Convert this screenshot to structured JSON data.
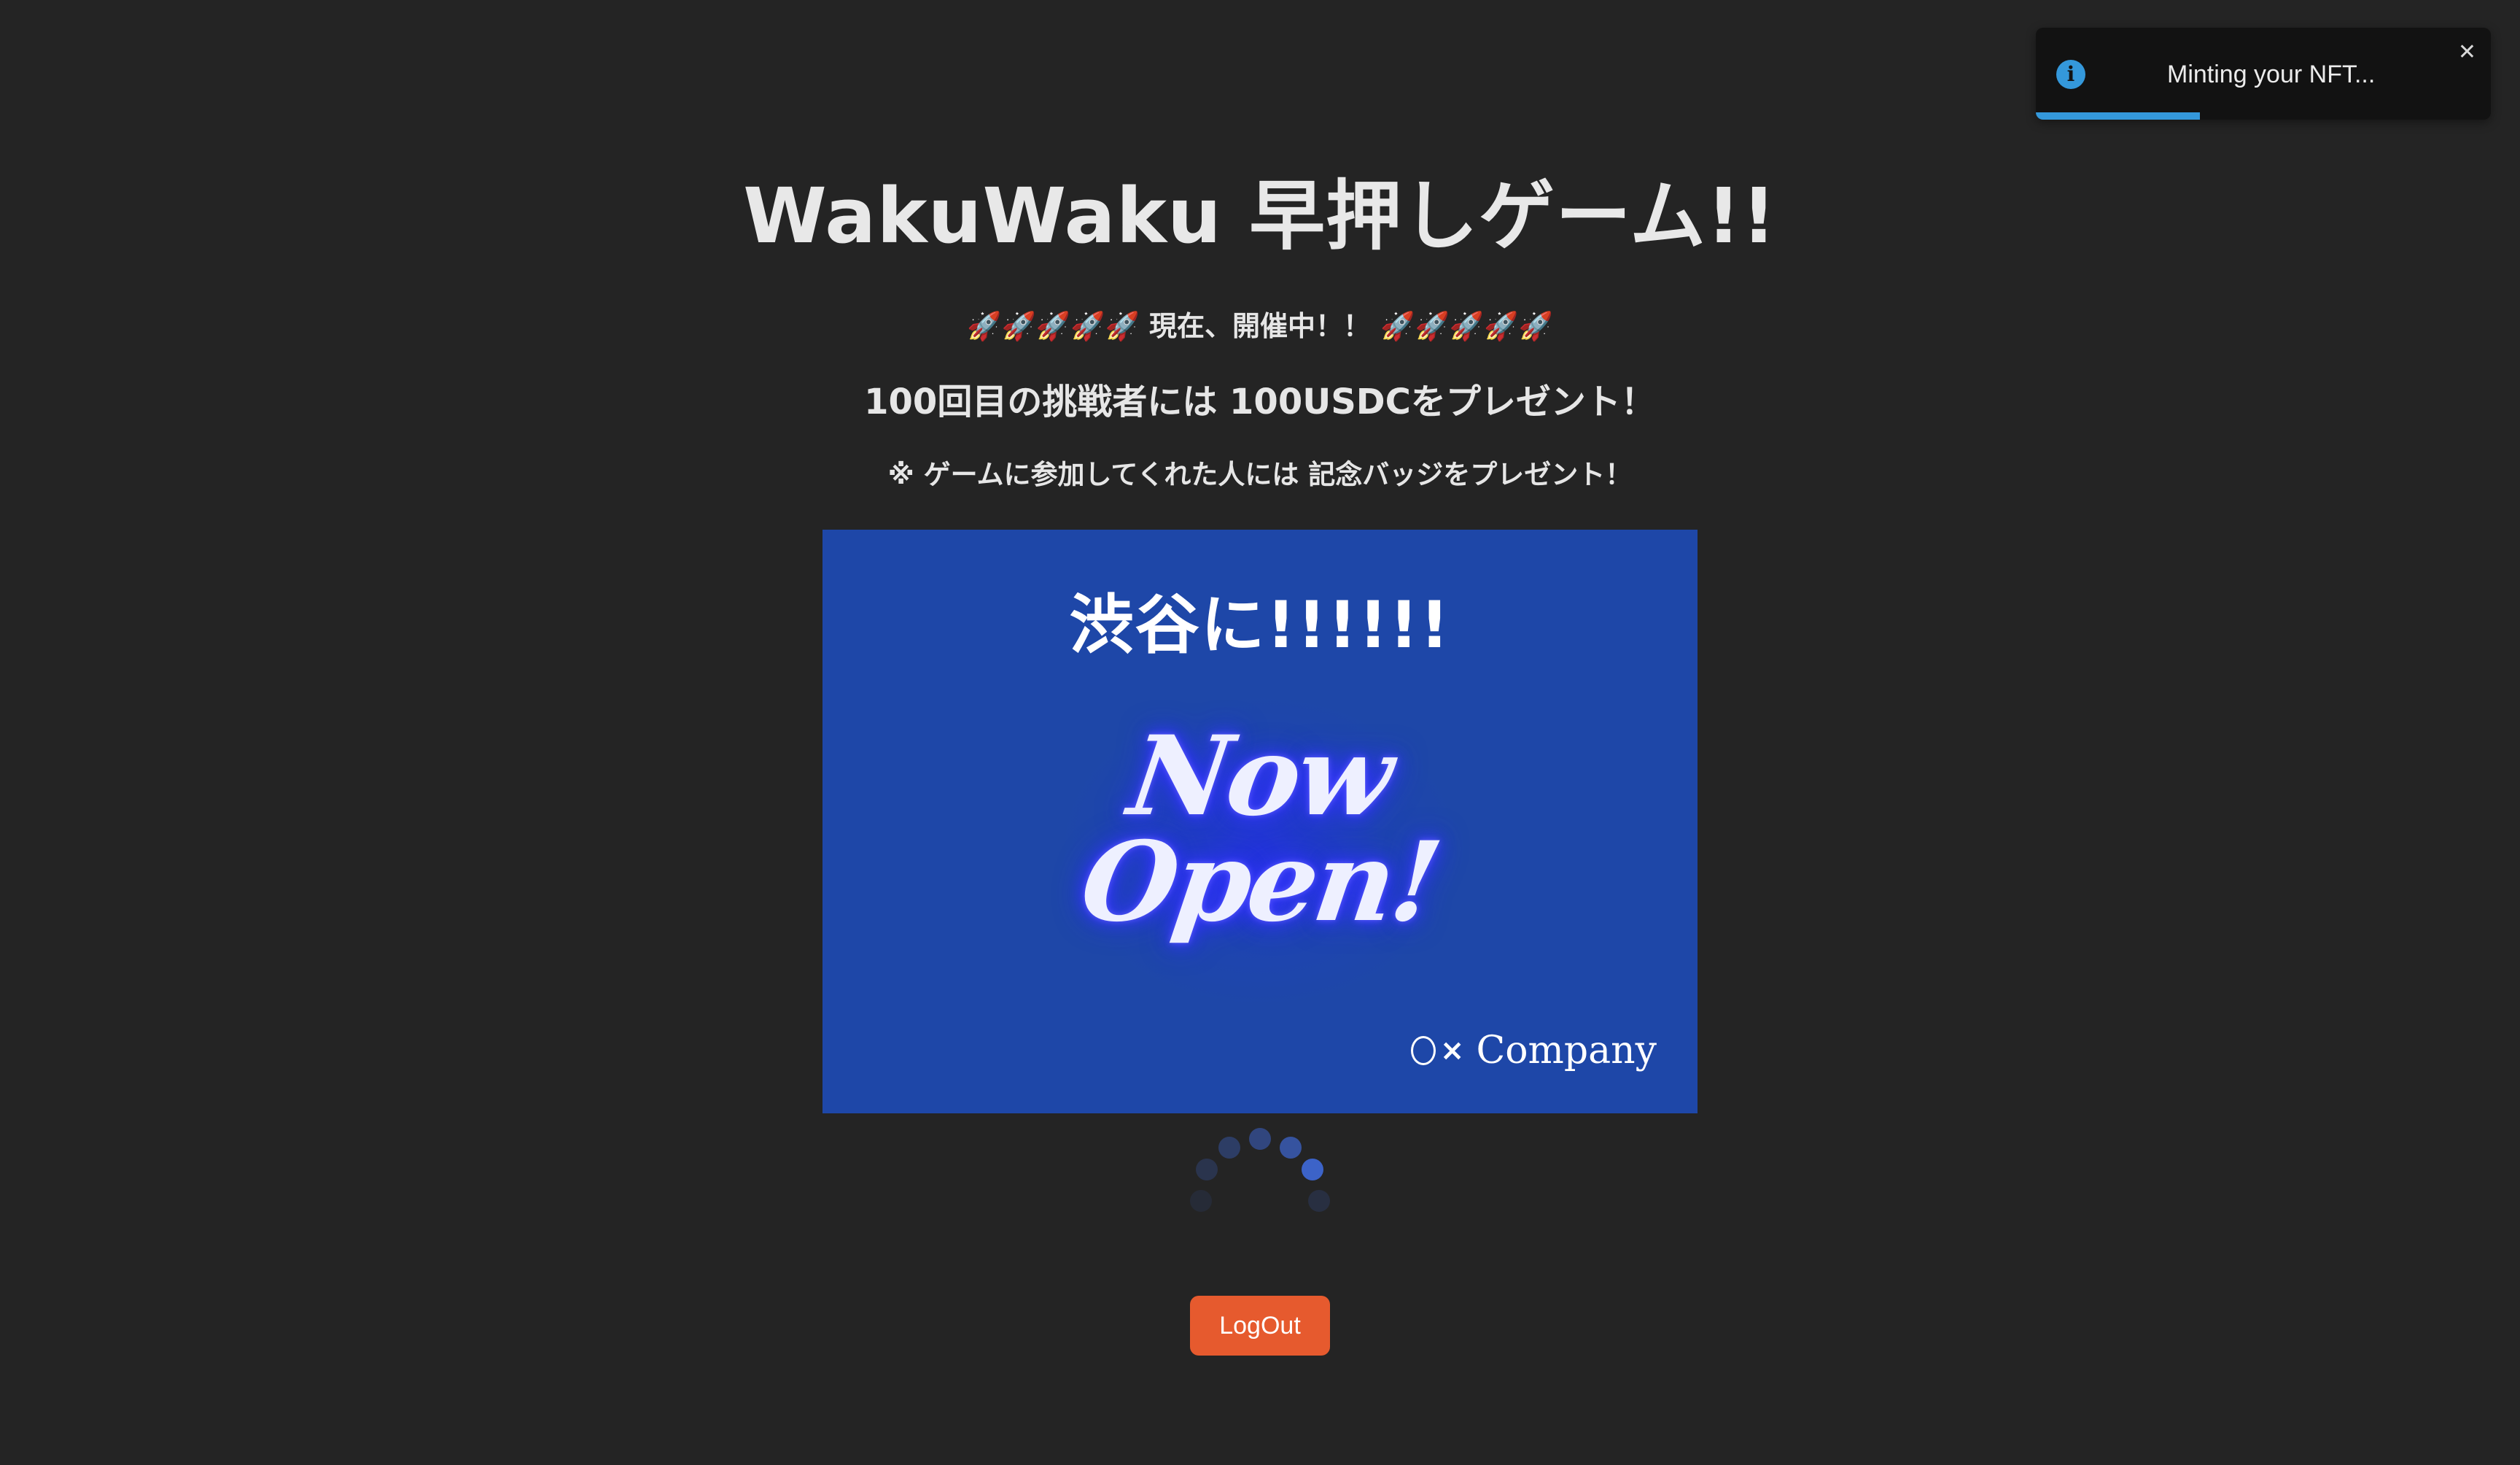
{
  "header": {
    "title": "WakuWaku 早押しゲーム!!",
    "status_line": "🚀🚀🚀🚀🚀 現在、開催中！！ 🚀🚀🚀🚀🚀",
    "prize_line": "100回目の挑戦者には 100USDCをプレゼント！",
    "badge_line": "※ ゲームに参加してくれた人には 記念バッジをプレゼント！"
  },
  "banner": {
    "heading": "渋谷に!!!!!!",
    "neon_line1": "Now",
    "neon_line2": "Open!",
    "company_mark": "×",
    "company_name": "Company",
    "background_color": "#1e47a8"
  },
  "spinner": {
    "icon": "loading-spinner-icon",
    "color": "#3c63c8"
  },
  "actions": {
    "logout_label": "LogOut",
    "logout_color": "#e65a2e"
  },
  "toast": {
    "message": "Minting your NFT...",
    "info_icon": "info-icon",
    "info_glyph": "i",
    "close_icon": "close-icon",
    "close_glyph": "✕",
    "progress_fraction": 0.36,
    "accent_color": "#3498db"
  }
}
